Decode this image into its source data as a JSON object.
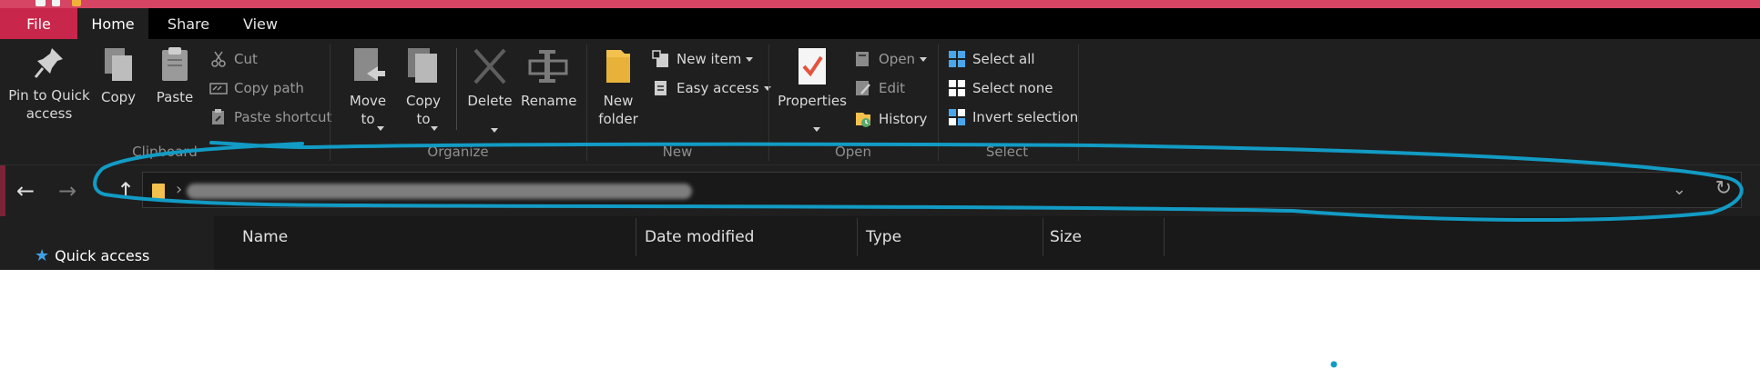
{
  "tabs": [
    {
      "label": "File"
    },
    {
      "label": "Home"
    },
    {
      "label": "Share"
    },
    {
      "label": "View"
    }
  ],
  "ribbon": {
    "clipboard": {
      "pin_label": "Pin to Quick access",
      "copy_label": "Copy",
      "paste_label": "Paste",
      "cut_label": "Cut",
      "copy_path_label": "Copy path",
      "paste_shortcut_label": "Paste shortcut",
      "group_label": "Clipboard"
    },
    "organize": {
      "move_to_label": "Move to",
      "copy_to_label": "Copy to",
      "delete_label": "Delete",
      "rename_label": "Rename",
      "group_label": "Organize"
    },
    "new": {
      "new_folder_label": "New folder",
      "new_item_label": "New item",
      "easy_access_label": "Easy access",
      "group_label": "New"
    },
    "open": {
      "properties_label": "Properties",
      "open_label": "Open",
      "edit_label": "Edit",
      "history_label": "History",
      "group_label": "Open"
    },
    "select": {
      "select_all_label": "Select all",
      "select_none_label": "Select none",
      "invert_selection_label": "Invert selection",
      "group_label": "Select"
    }
  },
  "navigation": {
    "back_icon": "arrow-left-icon",
    "forward_icon": "arrow-right-icon",
    "recent_icon": "chevron-down-icon",
    "up_icon": "arrow-up-icon",
    "refresh_icon": "refresh-icon"
  },
  "sidebar": {
    "quick_access_label": "Quick access"
  },
  "file_list": {
    "columns": [
      "Name",
      "Date modified",
      "Type",
      "Size"
    ]
  },
  "colors": {
    "accent_file_tab": "#c8264a",
    "background": "#1f1f1f",
    "annotation_stroke": "#129bc4"
  }
}
